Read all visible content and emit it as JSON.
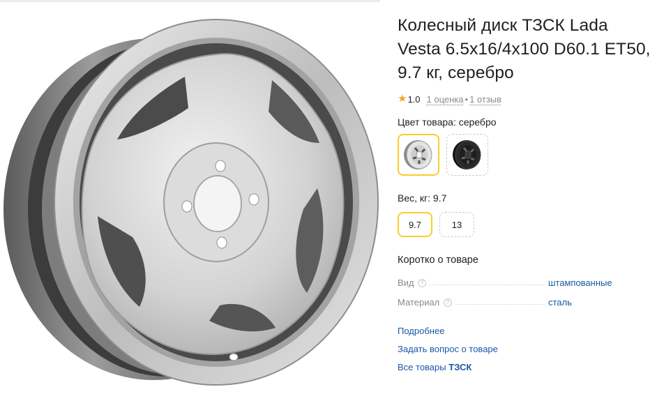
{
  "product": {
    "title": "Колесный диск ТЗСК Lada Vesta 6.5x16/4x100 D60.1 ET50, 9.7 кг, серебро"
  },
  "rating": {
    "star_icon": "star-icon",
    "value": "1.0",
    "ratings_count": "1 оценка",
    "separator": "•",
    "reviews_count": "1 отзыв"
  },
  "color": {
    "label": "Цвет товара: серебро",
    "options": [
      {
        "name": "серебро",
        "swatch_color": "#c8c8c8",
        "selected": true
      },
      {
        "name": "черный",
        "swatch_color": "#1d1d1d",
        "selected": false
      }
    ]
  },
  "weight": {
    "label": "Вес, кг: 9.7",
    "options": [
      {
        "value": "9.7",
        "selected": true
      },
      {
        "value": "13",
        "selected": false
      }
    ]
  },
  "about": {
    "title": "Коротко о товаре",
    "specs": [
      {
        "name": "Вид",
        "help_icon": "?",
        "value": "штампованные"
      },
      {
        "name": "Материал",
        "help_icon": "?",
        "value": "сталь"
      }
    ]
  },
  "links": {
    "more": "Подробнее",
    "ask": "Задать вопрос о товаре",
    "all_goods_prefix": "Все товары",
    "all_goods_brand": "ТЗСК"
  },
  "colors": {
    "accent_yellow": "#fccc2c",
    "link_blue": "#1a58a8",
    "star_orange": "#f5a623",
    "muted_gray": "#8a8a8a"
  }
}
